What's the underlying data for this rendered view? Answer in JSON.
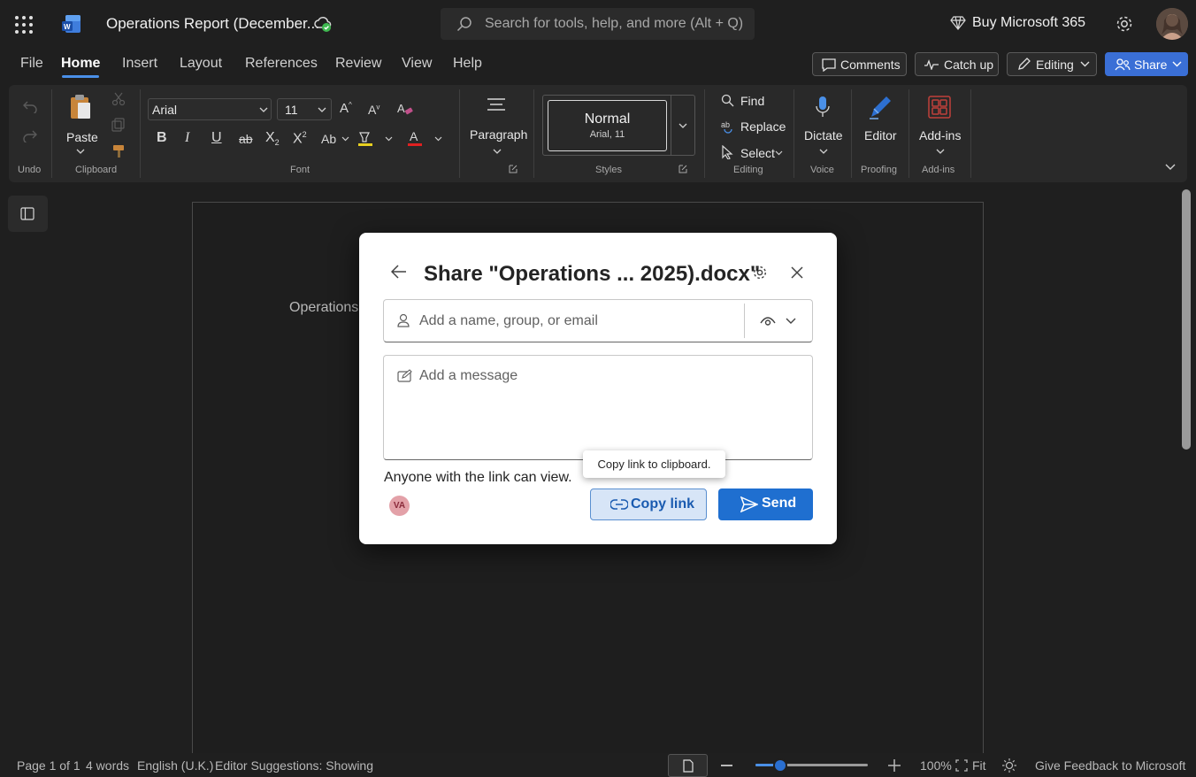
{
  "app": {
    "doc_title": "Operations Report (December...",
    "search_placeholder": "Search for tools, help, and more (Alt + Q)",
    "buy_label": "Buy Microsoft 365"
  },
  "menu": {
    "tabs": [
      "File",
      "Home",
      "Insert",
      "Layout",
      "References",
      "Review",
      "View",
      "Help"
    ],
    "active_tab": "Home",
    "comments_label": "Comments",
    "catchup_label": "Catch up",
    "editing_label": "Editing",
    "share_label": "Share"
  },
  "ribbon": {
    "undo_group": "Undo",
    "paste_label": "Paste",
    "clipboard_group": "Clipboard",
    "font_name": "Arial",
    "font_size": "11",
    "font_group": "Font",
    "paragraph_label": "Paragraph",
    "style_name": "Normal",
    "style_font": "Arial, 11",
    "styles_group": "Styles",
    "find_label": "Find",
    "replace_label": "Replace",
    "select_label": "Select",
    "editing_group": "Editing",
    "dictate_label": "Dictate",
    "voice_group": "Voice",
    "editor_label": "Editor",
    "proofing_group": "Proofing",
    "addins_label": "Add-ins",
    "addins_group": "Add-ins"
  },
  "document": {
    "visible_text": "Operations"
  },
  "dialog": {
    "title": "Share \"Operations ... 2025).docx\"",
    "name_placeholder": "Add a name, group, or email",
    "message_placeholder": "Add a message",
    "permission_text": "Anyone with the link can view.",
    "avatar_initials": "VA",
    "copy_link_label": "Copy link",
    "send_label": "Send",
    "tooltip": "Copy link to clipboard."
  },
  "status": {
    "page": "Page 1 of 1",
    "words": "4 words",
    "language": "English (U.K.)",
    "editor": "Editor Suggestions: Showing",
    "zoom": "100%",
    "fit": "Fit",
    "feedback": "Give Feedback to Microsoft"
  },
  "colors": {
    "accent": "#3a6fd6",
    "background": "#1f1f1f",
    "ribbon": "#292929",
    "dialog": "#ffffff"
  }
}
